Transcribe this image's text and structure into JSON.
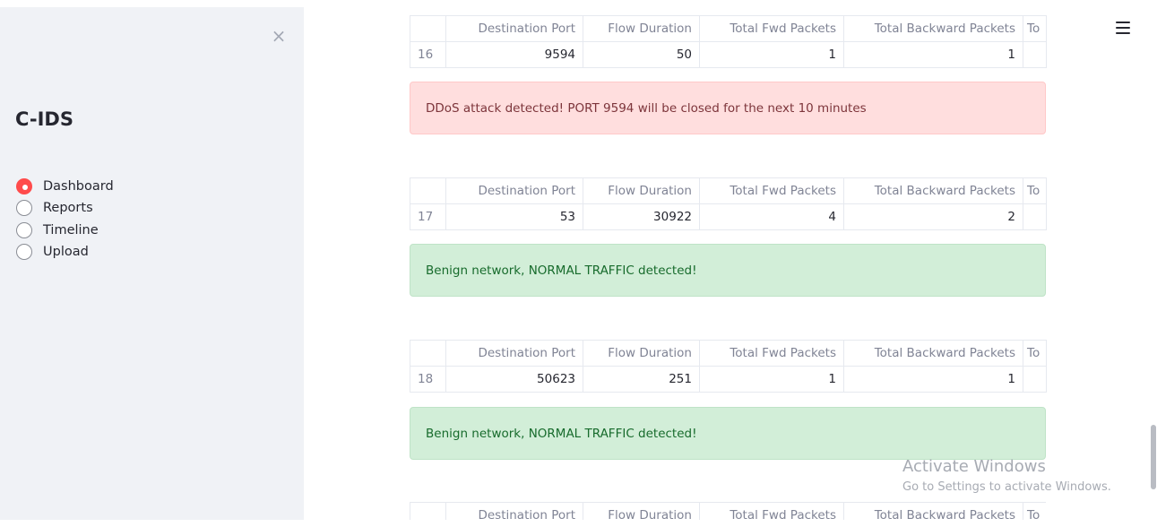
{
  "sidebar": {
    "close_icon": "×",
    "app_title": "C-IDS",
    "nav": [
      {
        "label": "Dashboard",
        "selected": true
      },
      {
        "label": "Reports",
        "selected": false
      },
      {
        "label": "Timeline",
        "selected": false
      },
      {
        "label": "Upload",
        "selected": false
      }
    ]
  },
  "columns": [
    "",
    "Destination Port",
    "Flow Duration",
    "Total Fwd Packets",
    "Total Backward Packets",
    "To"
  ],
  "results": [
    {
      "row": {
        "index": "16",
        "destination_port": "9594",
        "flow_duration": "50",
        "total_fwd_packets": "1",
        "total_backward_packets": "1"
      },
      "alert": {
        "type": "error",
        "message": "DDoS attack detected! PORT 9594 will be closed for the next 10 minutes"
      }
    },
    {
      "row": {
        "index": "17",
        "destination_port": "53",
        "flow_duration": "30922",
        "total_fwd_packets": "4",
        "total_backward_packets": "2"
      },
      "alert": {
        "type": "success",
        "message": "Benign network, NORMAL TRAFFIC detected!"
      }
    },
    {
      "row": {
        "index": "18",
        "destination_port": "50623",
        "flow_duration": "251",
        "total_fwd_packets": "1",
        "total_backward_packets": "1"
      },
      "alert": {
        "type": "success",
        "message": "Benign network, NORMAL TRAFFIC detected!"
      }
    }
  ],
  "watermark": {
    "title": "Activate Windows",
    "subtitle": "Go to Settings to activate Windows."
  },
  "icons": {
    "close": "close-icon",
    "menu": "hamburger-menu-icon"
  },
  "colors": {
    "accent": "#ff4b4b",
    "sidebar_bg": "#f0f2f6",
    "error_bg": "#ffdede",
    "success_bg": "#d2eed8"
  }
}
